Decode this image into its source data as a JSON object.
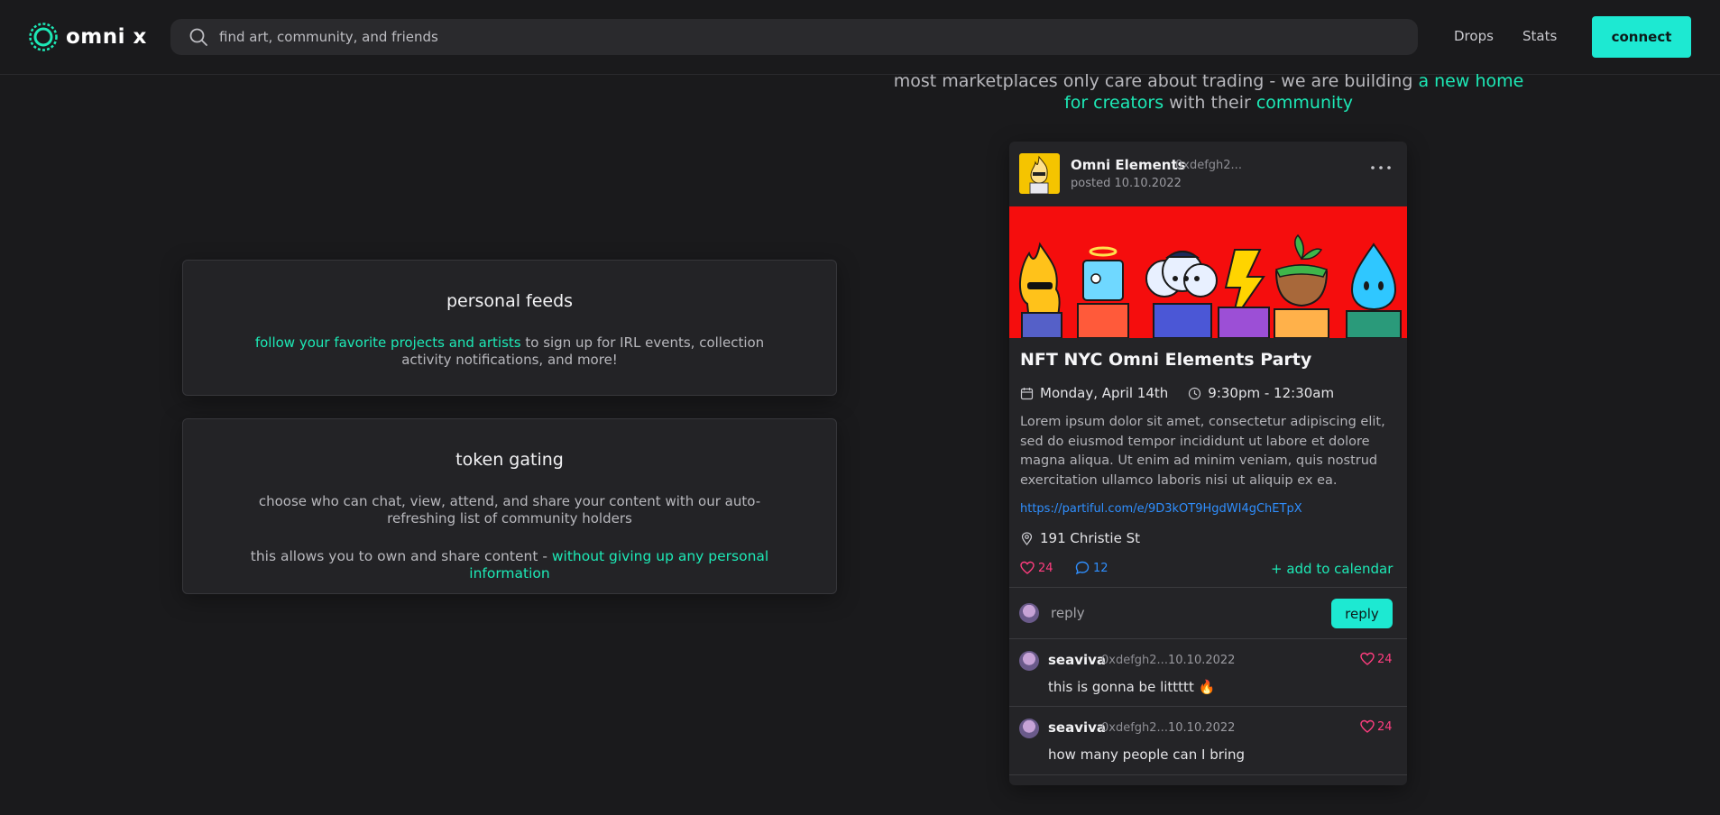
{
  "app": {
    "name": "omni x"
  },
  "colors": {
    "accent": "#1de9b6",
    "button": "#1de9d2",
    "like": "#ff3d7f",
    "link": "#2f8fff",
    "banner": "#f50d0d"
  },
  "header": {
    "search_placeholder": "find art, community, and friends",
    "nav": [
      "Drops",
      "Stats"
    ],
    "connect_label": "connect"
  },
  "tagline": {
    "part1": "most marketplaces only care about trading - we are building ",
    "highlight1": "a new home for creators",
    "part2": " with their ",
    "highlight2": "community"
  },
  "features": {
    "personal_feeds": {
      "title": "personal feeds",
      "highlight": "follow your favorite projects and artists",
      "text": " to sign up for IRL events, collection activity notifications, and more!"
    },
    "token_gating": {
      "title": "token gating",
      "text1": "choose who can chat, view, attend, and share your content with our auto-refreshing list of community holders",
      "text2": "this allows you to own and share content - ",
      "highlight": "without giving up any personal information"
    }
  },
  "post": {
    "author": "Omni Elements",
    "address": "0xdefgh2...",
    "posted": "posted 10.10.2022",
    "title": "NFT NYC Omni Elements Party",
    "date": "Monday, April 14th",
    "time": "9:30pm - 12:30am",
    "description": "Lorem ipsum dolor sit amet, consectetur adipiscing elit, sed do eiusmod tempor incididunt ut labore et dolore magna aliqua. Ut enim ad minim veniam, quis nostrud exercitation ullamco laboris nisi ut aliquip ex ea.",
    "link": "https://partiful.com/e/9D3kOT9HgdWI4gChETpX",
    "location": "191 Christie St",
    "likes": "24",
    "comments": "12",
    "add_to_calendar": "+ add to calendar",
    "reply_placeholder": "reply",
    "reply_button": "reply"
  },
  "comments": [
    {
      "name": "seaviva",
      "address": "0xdefgh2...",
      "date": "10.10.2022",
      "likes": "24",
      "text": "this is gonna be littttt 🔥"
    },
    {
      "name": "seaviva",
      "address": "0xdefgh2...",
      "date": "10.10.2022",
      "likes": "24",
      "text": "how many people can I bring"
    }
  ]
}
